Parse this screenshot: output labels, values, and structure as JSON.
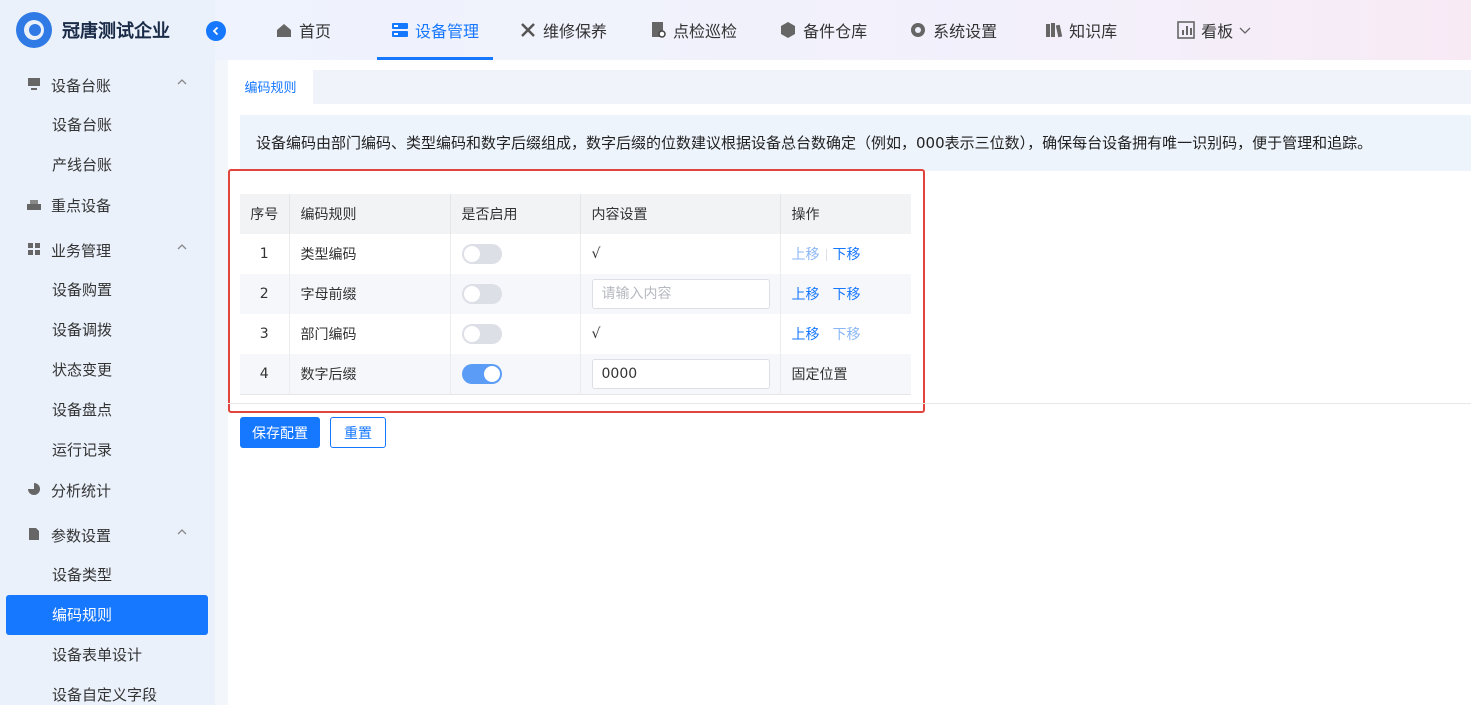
{
  "app": {
    "name": "冠唐测试企业"
  },
  "topnav": {
    "tabs": [
      {
        "label": "首页",
        "icon": "home-icon"
      },
      {
        "label": "设备管理",
        "icon": "device-icon",
        "active": true
      },
      {
        "label": "维修保养",
        "icon": "tools-icon"
      },
      {
        "label": "点检巡检",
        "icon": "inspection-icon"
      },
      {
        "label": "备件仓库",
        "icon": "box-icon"
      },
      {
        "label": "系统设置",
        "icon": "gear-icon"
      },
      {
        "label": "知识库",
        "icon": "books-icon"
      },
      {
        "label": "看板",
        "icon": "chart-icon"
      }
    ]
  },
  "sidebar": {
    "groups": [
      {
        "label": "设备台账",
        "icon": "monitor-icon"
      },
      {
        "label": "重点设备",
        "icon": "key-device-icon"
      },
      {
        "label": "业务管理",
        "icon": "grid-icon"
      },
      {
        "label": "分析统计",
        "icon": "pie-icon"
      },
      {
        "label": "参数设置",
        "icon": "document-icon"
      }
    ],
    "items": {
      "ledger": [
        "设备台账",
        "产线台账"
      ],
      "business": [
        "设备购置",
        "设备调拨",
        "状态变更",
        "设备盘点",
        "运行记录"
      ],
      "params": [
        "设备类型",
        "编码规则",
        "设备表单设计",
        "设备自定义字段"
      ]
    },
    "active_item": "编码规则"
  },
  "page": {
    "tab_label": "编码规则",
    "info_text": "设备编码由部门编码、类型编码和数字后缀组成，数字后缀的位数建议根据设备总台数确定（例如，000表示三位数），确保每台设备拥有唯一识别码，便于管理和追踪。"
  },
  "table": {
    "headers": [
      "序号",
      "编码规则",
      "是否启用",
      "内容设置",
      "操作"
    ],
    "rows": [
      {
        "no": "1",
        "rule": "类型编码",
        "enabled": false,
        "content": "√",
        "up": "上移",
        "down": "下移"
      },
      {
        "no": "2",
        "rule": "字母前缀",
        "enabled": false,
        "placeholder": "请输入内容",
        "up": "上移",
        "down": "下移"
      },
      {
        "no": "3",
        "rule": "部门编码",
        "enabled": false,
        "content": "√",
        "up": "上移",
        "down": "下移"
      },
      {
        "no": "4",
        "rule": "数字后缀",
        "enabled": true,
        "value": "0000",
        "op_text": "固定位置"
      }
    ]
  },
  "buttons": {
    "save": "保存配置",
    "reset": "重置"
  },
  "colors": {
    "primary": "#1677ff",
    "highlight": "#e0443c",
    "sidebar_bg": "#eaf1fb"
  }
}
